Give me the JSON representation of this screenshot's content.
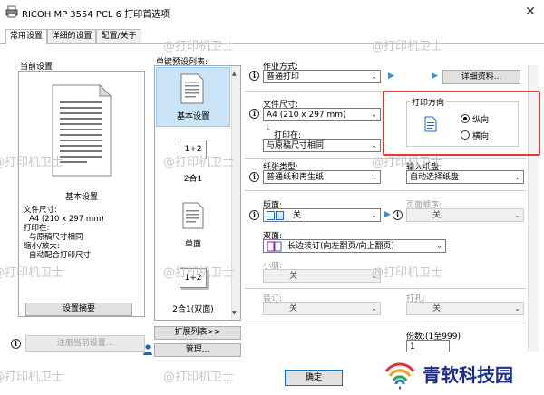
{
  "window": {
    "title": "RICOH MP 3554 PCL 6 打印首选项",
    "close": "✕"
  },
  "tabs": [
    {
      "label": "常用设置",
      "active": true
    },
    {
      "label": "详细的设置",
      "active": false
    },
    {
      "label": "配置/关于",
      "active": false
    }
  ],
  "current_settings": {
    "heading": "当前设置",
    "preview_caption": "基本设置",
    "details": [
      "文件尺寸:",
      "A4 (210 x 297 mm)",
      "打印在:",
      "与原稿尺寸相同",
      "缩小/放大:",
      "自动配合打印尺寸"
    ],
    "summary_button": "设置摘要",
    "register_button": "注册当前设置..."
  },
  "presets": {
    "heading": "单键预设列表:",
    "items": [
      {
        "label": "基本设置",
        "icon_text": ""
      },
      {
        "label": "2合1",
        "icon_text": "1+2"
      },
      {
        "label": "单面",
        "icon_text": ""
      },
      {
        "label": "2合1(双面)",
        "icon_text": "1+2"
      }
    ],
    "expand_button": "扩展列表>>",
    "manage_button": "管理..."
  },
  "job": {
    "label": "作业方式:",
    "value": "普通打印",
    "details_button": "详细资料..."
  },
  "paper_size": {
    "label": "文件尺寸:",
    "value": "A4 (210 x 297 mm)"
  },
  "print_on": {
    "label": "打印在:",
    "value": "与原稿尺寸相同"
  },
  "orientation": {
    "label": "打印方向",
    "options": [
      {
        "label": "纵向",
        "selected": true
      },
      {
        "label": "横向",
        "selected": false
      }
    ]
  },
  "paper_type": {
    "label": "纸张类型:",
    "value": "普通纸和再生纸"
  },
  "input_tray": {
    "label": "输入纸盘:",
    "value": "自动选择纸盘"
  },
  "layout": {
    "label": "版面:",
    "value": "关"
  },
  "page_order": {
    "label": "页面顺序:",
    "value": "关"
  },
  "duplex": {
    "label": "双面:",
    "value": "长边装订(向左翻页/向上翻页)"
  },
  "booklet": {
    "label": "小册:",
    "value": "关"
  },
  "staple": {
    "label": "装订:",
    "value": "关"
  },
  "punch": {
    "label": "打孔:",
    "value": "关"
  },
  "copies": {
    "label": "份数:(1至999)",
    "value": "1"
  },
  "ok_button": "确定",
  "watermark": {
    "text": "@打印机卫士",
    "brand": "青软科技园"
  }
}
